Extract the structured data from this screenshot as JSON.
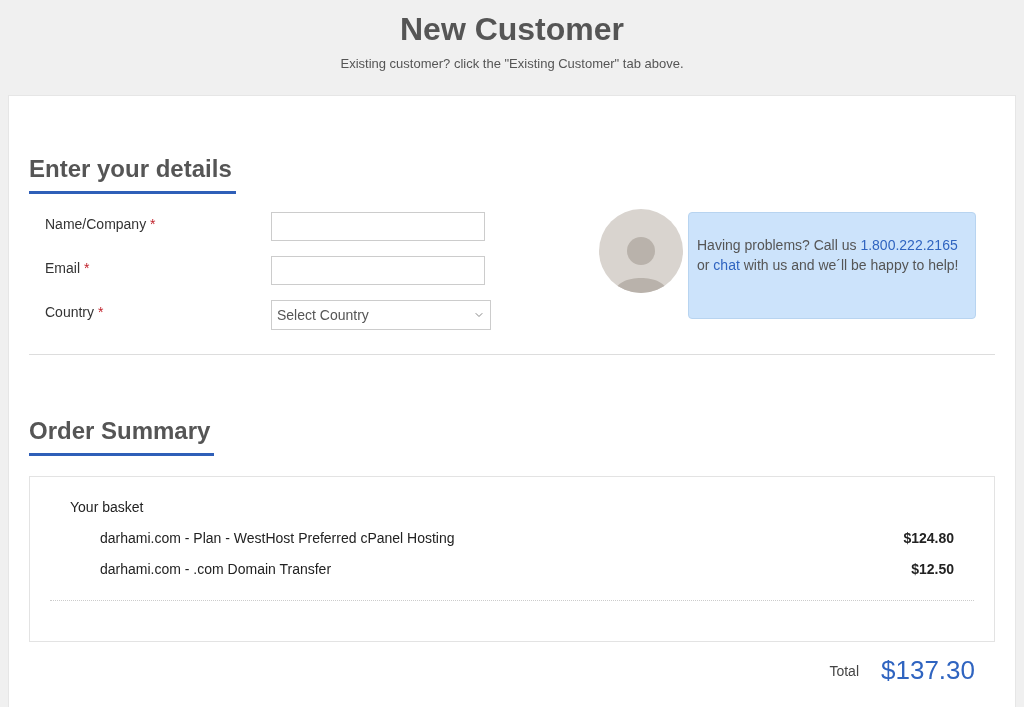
{
  "header": {
    "title": "New Customer",
    "subtitle": "Existing customer? click the \"Existing Customer\" tab above."
  },
  "details": {
    "heading": "Enter your details",
    "fields": [
      {
        "kind": "text",
        "label": "Name/Company",
        "required_mark": "*"
      },
      {
        "kind": "text",
        "label": "Email",
        "required_mark": "*"
      },
      {
        "kind": "select",
        "label": "Country",
        "required_mark": "*",
        "placeholder": "Select Country"
      }
    ]
  },
  "support": {
    "before": "Having problems? Call us ",
    "phone": "1.800.222.2165",
    "middle": " or ",
    "chat": "chat",
    "after": " with us and we´ll be happy to help!"
  },
  "order": {
    "heading": "Order Summary",
    "basket_label": "Your basket",
    "items": [
      {
        "name": "darhami.com - Plan - WestHost Preferred cPanel Hosting",
        "price": "$124.80"
      },
      {
        "name": "darhami.com - .com Domain Transfer",
        "price": "$12.50"
      }
    ],
    "total_label": "Total",
    "total": "$137.30"
  }
}
